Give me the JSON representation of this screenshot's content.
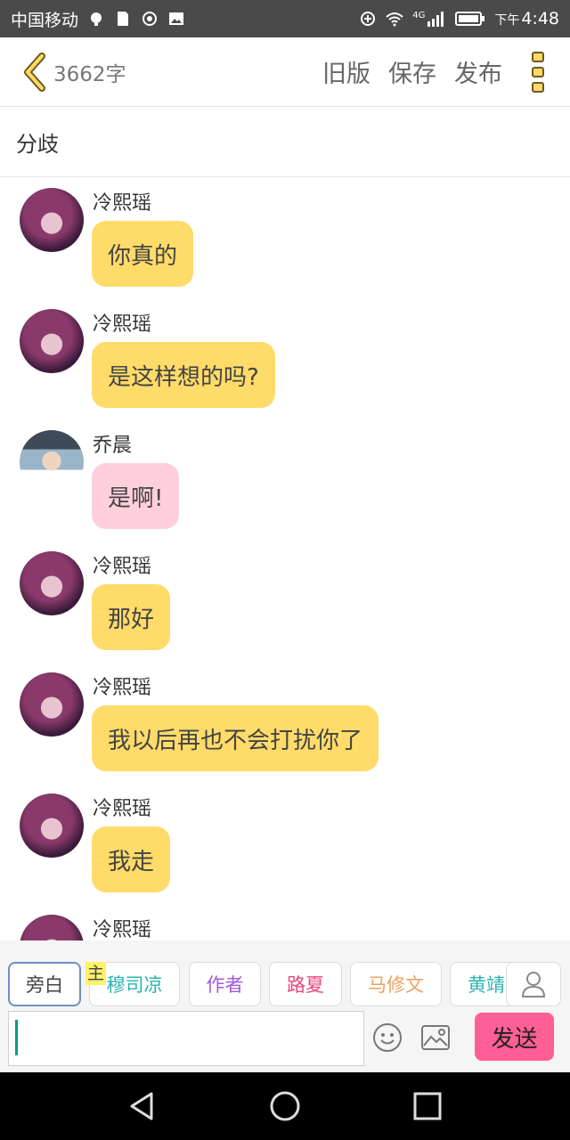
{
  "status_bar": {
    "carrier": "中国移动",
    "network": "4G",
    "time_prefix": "下午",
    "time": "4:48"
  },
  "header": {
    "word_count": "3662字",
    "old_version_label": "旧版",
    "save_label": "保存",
    "publish_label": "发布"
  },
  "chapter_title": "分歧",
  "messages": [
    {
      "sender": "冷熙瑶",
      "text": "你真的",
      "bubble_color": "#ffdb69"
    },
    {
      "sender": "冷熙瑶",
      "text": "是这样想的吗?",
      "bubble_color": "#ffdb69"
    },
    {
      "sender": "乔晨",
      "text": "是啊!",
      "bubble_color": "#ffd0dc"
    },
    {
      "sender": "冷熙瑶",
      "text": "那好",
      "bubble_color": "#ffdb69"
    },
    {
      "sender": "冷熙瑶",
      "text": "我以后再也不会打扰你了",
      "bubble_color": "#ffdb69"
    },
    {
      "sender": "冷熙瑶",
      "text": "我走",
      "bubble_color": "#ffdb69"
    },
    {
      "sender": "冷熙瑶",
      "text": "",
      "bubble_color": "#ffdb69"
    }
  ],
  "roles": {
    "main_tag": "主",
    "items": [
      {
        "label": "旁白",
        "color": "#444444"
      },
      {
        "label": "穆司凉",
        "color": "#2bb3b3"
      },
      {
        "label": "作者",
        "color": "#a55ad6"
      },
      {
        "label": "路夏",
        "color": "#e8467c"
      },
      {
        "label": "马修文",
        "color": "#f0a060"
      },
      {
        "label": "黄靖",
        "color": "#2bb3b3"
      }
    ]
  },
  "composer": {
    "input_value": "",
    "send_label": "发送"
  }
}
